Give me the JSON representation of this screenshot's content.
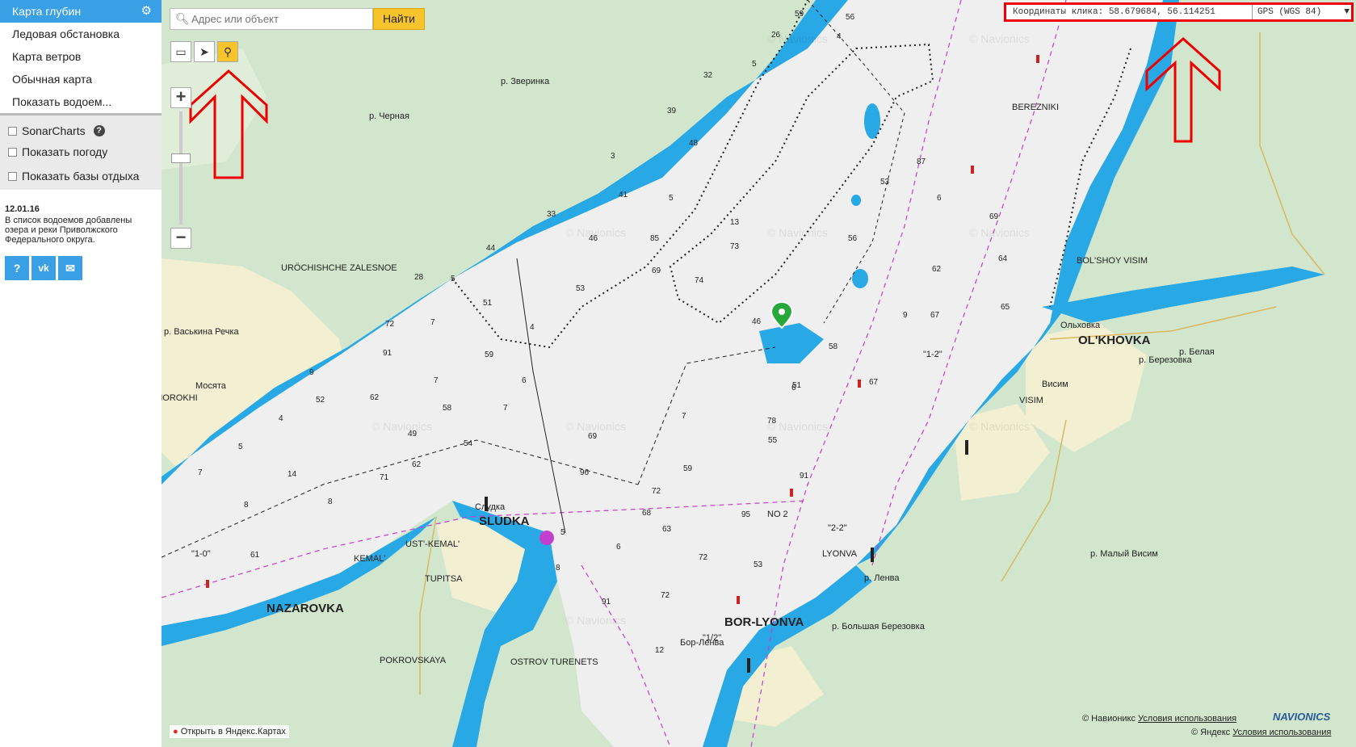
{
  "sidebar": {
    "menu": [
      {
        "label": "Карта глубин",
        "active": true
      },
      {
        "label": "Ледовая обстановка"
      },
      {
        "label": "Карта ветров"
      },
      {
        "label": "Обычная карта"
      },
      {
        "label": "Показать водоем..."
      }
    ],
    "options": [
      {
        "label": "SonarCharts",
        "checked": false
      },
      {
        "label": "Показать погоду",
        "checked": false
      },
      {
        "label": "Показать базы отдыха",
        "checked": false
      }
    ],
    "news_date": "12.01.16",
    "news_text": "В список водоемов добавлены озера и реки Приволжского Федерального округа.",
    "social": [
      "?",
      "vk",
      "mail"
    ]
  },
  "search": {
    "placeholder": "Адрес или объект",
    "button": "Найти"
  },
  "coords": {
    "label": "Координаты клика: 58.679684, 56.114251",
    "format": "GPS (WGS 84)"
  },
  "credits": {
    "navionics": "© Навионикс",
    "navionics_terms": "Условия использования",
    "yandex": "© Яндекс",
    "yandex_terms": "Условия использования",
    "open_yandex": "Открыть в Яндекс.Картах",
    "brand": "NAVIONICS"
  },
  "watermark": "© Navionics",
  "places": [
    {
      "text": "OL'KHOVKA",
      "big": true
    },
    {
      "text": "Ольховка"
    },
    {
      "text": "SLUDKA",
      "big": true
    },
    {
      "text": "Слудка"
    },
    {
      "text": "NAZAROVKA",
      "big": true
    },
    {
      "text": "BOR-LYONVA",
      "big": true
    },
    {
      "text": "Бор-Ленва"
    },
    {
      "text": "BEREZNIKI"
    },
    {
      "text": "BOL'SHOY VISIM"
    },
    {
      "text": "VISIM"
    },
    {
      "text": "Висим"
    },
    {
      "text": "URÖCHISHCHE ZALESNOE"
    },
    {
      "text": "SHOROKHI"
    },
    {
      "text": "Мосята"
    },
    {
      "text": "UST'-KEMAL'"
    },
    {
      "text": "KEMAL'"
    },
    {
      "text": "TUPITSA"
    },
    {
      "text": "POKROVSKAYA"
    },
    {
      "text": "OSTROV TURENETS"
    },
    {
      "text": "LYONVA"
    },
    {
      "text": "NO 2"
    },
    {
      "text": "\"2-2\""
    },
    {
      "text": "\"1-2\""
    },
    {
      "text": "\"1-0\""
    },
    {
      "text": "\"1/2\""
    },
    {
      "text": "р. Зверинка"
    },
    {
      "text": "р. Черная"
    },
    {
      "text": "р. Васькина Речка"
    },
    {
      "text": "р. Ленва"
    },
    {
      "text": "р. Белая"
    },
    {
      "text": "р. Березовка"
    },
    {
      "text": "р. Малый Висим"
    },
    {
      "text": "р. Большая Березовка"
    }
  ],
  "depths": [
    "59",
    "56",
    "26",
    "5",
    "4",
    "32",
    "39",
    "48",
    "3",
    "41",
    "5",
    "46",
    "33",
    "44",
    "28",
    "5",
    "51",
    "72",
    "4",
    "7",
    "53",
    "59",
    "6",
    "91",
    "7",
    "9",
    "52",
    "62",
    "4",
    "5",
    "58",
    "49",
    "54",
    "62",
    "71",
    "7",
    "14",
    "8",
    "8",
    "61",
    "68",
    "63",
    "96",
    "72",
    "5",
    "6",
    "8",
    "91",
    "72",
    "12",
    "72",
    "95",
    "7",
    "74",
    "13",
    "73",
    "85",
    "69",
    "53",
    "6",
    "56",
    "58",
    "51",
    "53",
    "62",
    "67",
    "69",
    "64",
    "65",
    "6",
    "9",
    "67",
    "91",
    "46",
    "87",
    "55",
    "59",
    "69",
    "7",
    "78",
    "69",
    "65",
    "6",
    "71",
    "75",
    "73",
    "81",
    "9",
    "57"
  ]
}
